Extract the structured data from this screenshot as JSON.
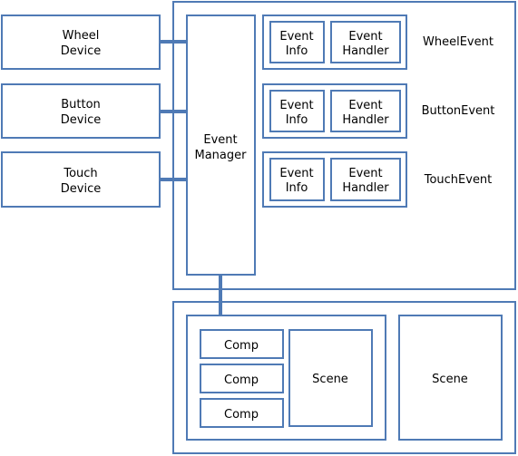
{
  "colors": {
    "stroke": "#4f7ab5"
  },
  "devices": [
    [
      "Wheel",
      "Device"
    ],
    [
      "Button",
      "Device"
    ],
    [
      "Touch",
      "Device"
    ]
  ],
  "manager": [
    "Event",
    "Manager"
  ],
  "events": [
    {
      "info": [
        "Event",
        "Info"
      ],
      "handler": [
        "Event",
        "Handler"
      ],
      "label": "WheelEvent"
    },
    {
      "info": [
        "Event",
        "Info"
      ],
      "handler": [
        "Event",
        "Handler"
      ],
      "label": "ButtonEvent"
    },
    {
      "info": [
        "Event",
        "Info"
      ],
      "handler": [
        "Event",
        "Handler"
      ],
      "label": "TouchEvent"
    }
  ],
  "comps": [
    "Comp",
    "Comp",
    "Comp"
  ],
  "scene_inner": "Scene",
  "scene_right": "Scene"
}
